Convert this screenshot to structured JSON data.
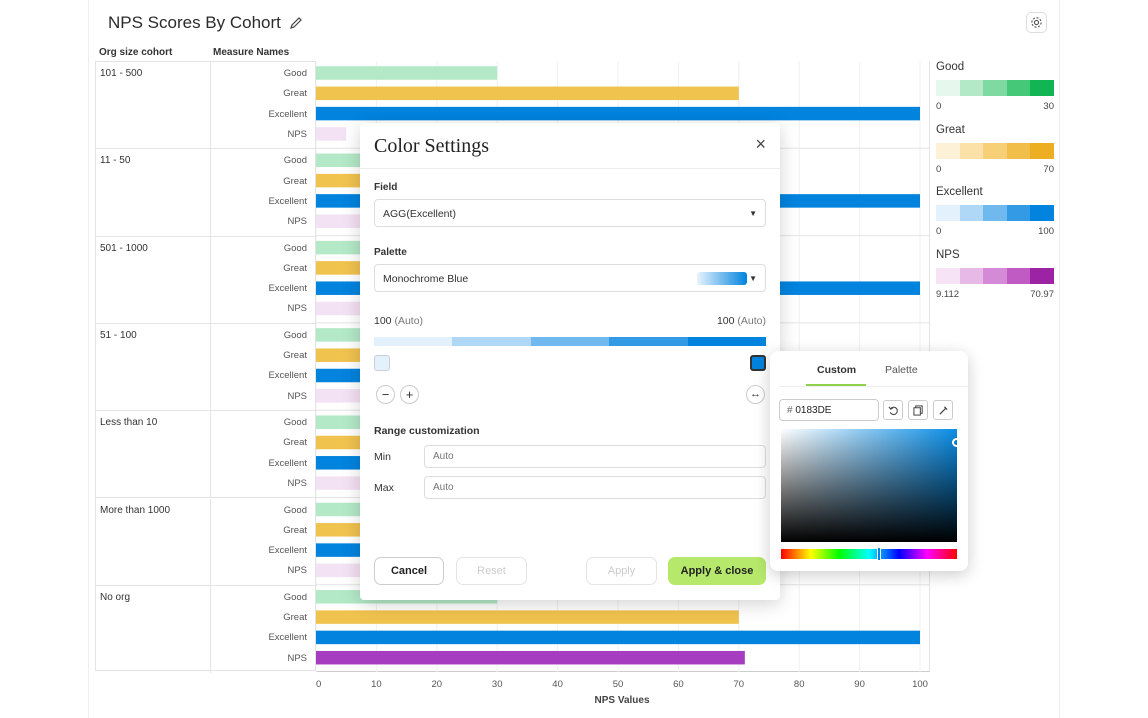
{
  "worksheet": {
    "title": "NPS Scores By Cohort",
    "col_headers": [
      "Org size cohort",
      "Measure Names"
    ],
    "x_axis_title": "NPS Values",
    "x_ticks": [
      "0",
      "10",
      "20",
      "30",
      "40",
      "50",
      "60",
      "70",
      "80",
      "90",
      "100"
    ]
  },
  "chart_data": {
    "type": "bar",
    "orientation": "horizontal",
    "xlabel": "NPS Values",
    "xlim": [
      0,
      100
    ],
    "grid": true,
    "measures": [
      "Good",
      "Great",
      "Excellent",
      "NPS"
    ],
    "series_colors": {
      "Good": "#b3e9c7",
      "Great": "#f0c24e",
      "Excellent": "#0183DE",
      "NPS": "#a63cc0"
    },
    "cohorts": [
      {
        "name": "101 - 500",
        "values": {
          "Good": 30,
          "Great": 70,
          "Excellent": 100,
          "NPS": 5
        }
      },
      {
        "name": "11 - 50",
        "values": {
          "Good": 30,
          "Great": 70,
          "Excellent": 100,
          "NPS": 14
        }
      },
      {
        "name": "501 - 1000",
        "values": {
          "Good": 30,
          "Great": 70,
          "Excellent": 100,
          "NPS": 12
        }
      },
      {
        "name": "51 - 100",
        "values": {
          "Good": 30,
          "Great": 70,
          "Excellent": 100,
          "NPS": 16
        }
      },
      {
        "name": "Less than 10",
        "values": {
          "Good": 30,
          "Great": 70,
          "Excellent": 100,
          "NPS": 10
        }
      },
      {
        "name": "More than 1000",
        "values": {
          "Good": 30,
          "Great": 70,
          "Excellent": 100,
          "NPS": 11
        }
      },
      {
        "name": "No org",
        "values": {
          "Good": 30,
          "Great": 70,
          "Excellent": 100,
          "NPS": 71
        }
      }
    ]
  },
  "legend": [
    {
      "title": "Good",
      "min": "0",
      "max": "30",
      "colors": [
        "#e6f8ee",
        "#b4e9c8",
        "#7fdaa2",
        "#45c978",
        "#12b554"
      ]
    },
    {
      "title": "Great",
      "min": "0",
      "max": "70",
      "colors": [
        "#fdf1d7",
        "#fbe0a8",
        "#f6cf77",
        "#f2be4a",
        "#ecaf23"
      ]
    },
    {
      "title": "Excellent",
      "min": "0",
      "max": "100",
      "colors": [
        "#e3f1fc",
        "#aed8f6",
        "#6fb9ee",
        "#339be6",
        "#0183DE"
      ]
    },
    {
      "title": "NPS",
      "min": "9.112",
      "max": "70.97",
      "colors": [
        "#f6e3f6",
        "#e7b9e7",
        "#d48ad6",
        "#bf5bc3",
        "#9c23a4"
      ]
    }
  ],
  "modal": {
    "title": "Color Settings",
    "close_icon": "×",
    "field_label": "Field",
    "field_value": "AGG(Excellent)",
    "palette_label": "Palette",
    "palette_value": "Monochrome Blue",
    "range_left": "100",
    "range_right": "100",
    "auto_suffix": "(Auto)",
    "range_colors": [
      "#e3f1fc",
      "#aed8f6",
      "#6fb9ee",
      "#339be6",
      "#0183DE"
    ],
    "range_title": "Range customization",
    "min_label": "Min",
    "max_label": "Max",
    "min_placeholder": "Auto",
    "max_placeholder": "Auto",
    "cancel": "Cancel",
    "reset": "Reset",
    "apply": "Apply",
    "apply_close": "Apply & close"
  },
  "picker": {
    "tab_custom": "Custom",
    "tab_palette": "Palette",
    "hex_prefix": "#",
    "hex_value": "0183DE"
  }
}
